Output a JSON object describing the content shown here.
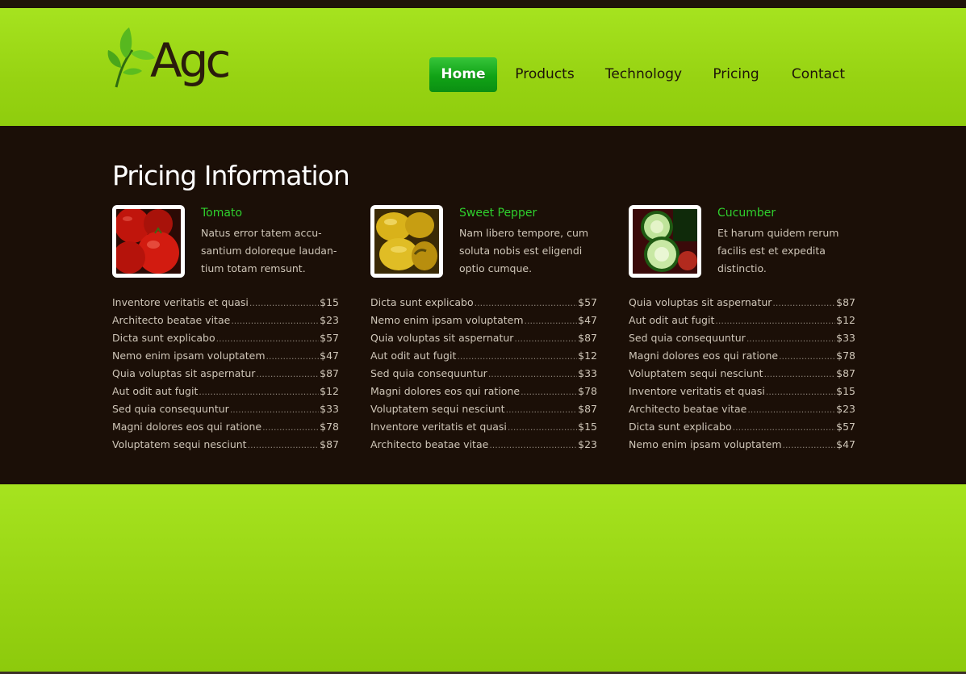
{
  "brand": {
    "name": "Agc"
  },
  "nav": [
    {
      "label": "Home",
      "active": true
    },
    {
      "label": "Products",
      "active": false
    },
    {
      "label": "Technology",
      "active": false
    },
    {
      "label": "Pricing",
      "active": false
    },
    {
      "label": "Contact",
      "active": false
    }
  ],
  "page_title": "Pricing Information",
  "colors": {
    "header_green": "#9fdc1a",
    "content_bg": "#1b0f07",
    "accent_green": "#2fd02d",
    "nav_active": "#11a316"
  },
  "products": [
    {
      "name": "Tomato",
      "image_icon": "tomato-photo",
      "desc": "Natus error tatem accu-santium doloreque laudan-tium totam remsunt.",
      "prices": [
        {
          "item": "Inventore veritatis et quasi",
          "price": "$15"
        },
        {
          "item": "Architecto beatae vitae",
          "price": "$23"
        },
        {
          "item": "Dicta sunt explicabo",
          "price": "$57"
        },
        {
          "item": "Nemo enim ipsam voluptatem",
          "price": "$47"
        },
        {
          "item": "Quia voluptas sit aspernatur",
          "price": "$87"
        },
        {
          "item": "Aut odit aut fugit",
          "price": "$12"
        },
        {
          "item": "Sed quia consequuntur",
          "price": "$33"
        },
        {
          "item": "Magni dolores eos qui ratione",
          "price": "$78"
        },
        {
          "item": "Voluptatem sequi nesciunt",
          "price": "$87"
        }
      ]
    },
    {
      "name": "Sweet Pepper",
      "image_icon": "pepper-photo",
      "desc": "Nam libero tempore, cum soluta nobis est eligendi optio cumque.",
      "prices": [
        {
          "item": "Dicta sunt explicabo",
          "price": "$57"
        },
        {
          "item": "Nemo enim ipsam voluptatem",
          "price": "$47"
        },
        {
          "item": "Quia voluptas sit aspernatur",
          "price": "$87"
        },
        {
          "item": "Aut odit aut fugit",
          "price": "$12"
        },
        {
          "item": "Sed quia consequuntur",
          "price": "$33"
        },
        {
          "item": "Magni dolores eos qui ratione",
          "price": "$78"
        },
        {
          "item": "Voluptatem sequi nesciunt",
          "price": "$87"
        },
        {
          "item": "Inventore veritatis et quasi",
          "price": "$15"
        },
        {
          "item": "Architecto beatae vitae",
          "price": "$23"
        }
      ]
    },
    {
      "name": "Cucumber",
      "image_icon": "cucumber-photo",
      "desc": "Et harum quidem rerum facilis est et expedita distinctio.",
      "prices": [
        {
          "item": "Quia voluptas sit aspernatur",
          "price": "$87"
        },
        {
          "item": "Aut odit aut fugit",
          "price": "$12"
        },
        {
          "item": "Sed quia consequuntur",
          "price": "$33"
        },
        {
          "item": "Magni dolores eos qui ratione",
          "price": "$78"
        },
        {
          "item": "Voluptatem sequi nesciunt",
          "price": "$87"
        },
        {
          "item": "Inventore veritatis et quasi",
          "price": "$15"
        },
        {
          "item": "Architecto beatae vitae",
          "price": "$23"
        },
        {
          "item": "Dicta sunt explicabo",
          "price": "$57"
        },
        {
          "item": "Nemo enim ipsam voluptatem",
          "price": "$47"
        }
      ]
    }
  ]
}
